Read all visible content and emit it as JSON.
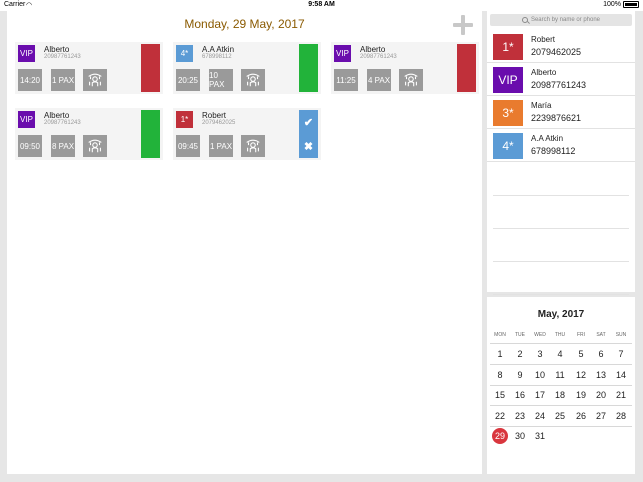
{
  "status_bar": {
    "carrier": "Carrier",
    "time": "9:58 AM",
    "battery": "100%"
  },
  "header": {
    "date": "Monday, 29 May, 2017"
  },
  "bookings": [
    {
      "badge": "VIP",
      "badge_color": "#6a0dad",
      "name": "Alberto",
      "phone": "20987761243",
      "time": "14:20",
      "pax": "1 PAX",
      "status": "red"
    },
    {
      "badge": "4*",
      "badge_color": "#5b9bd5",
      "name": "A.A Atkin",
      "phone": "678998112",
      "time": "20:25",
      "pax": "10 PAX",
      "status": "green"
    },
    {
      "badge": "VIP",
      "badge_color": "#6a0dad",
      "name": "Alberto",
      "phone": "20987761243",
      "time": "11:25",
      "pax": "4 PAX",
      "status": "red"
    },
    {
      "badge": "VIP",
      "badge_color": "#6a0dad",
      "name": "Alberto",
      "phone": "20987761243",
      "time": "09:50",
      "pax": "8 PAX",
      "status": "green"
    },
    {
      "badge": "1*",
      "badge_color": "#c0303a",
      "name": "Robert",
      "phone": "2079462025",
      "time": "09:45",
      "pax": "1 PAX",
      "status": "actions"
    }
  ],
  "actions": {
    "confirm_glyph": "✔",
    "cancel_glyph": "✖"
  },
  "search": {
    "placeholder": "Search by name or phone"
  },
  "contacts": [
    {
      "badge": "1*",
      "badge_color": "#c0303a",
      "name": "Robert",
      "phone": "2079462025"
    },
    {
      "badge": "VIP",
      "badge_color": "#6a0dad",
      "name": "Alberto",
      "phone": "20987761243"
    },
    {
      "badge": "3*",
      "badge_color": "#e97b2e",
      "name": "María",
      "phone": "2239876621"
    },
    {
      "badge": "4*",
      "badge_color": "#5b9bd5",
      "name": "A.A Atkin",
      "phone": "678998112"
    }
  ],
  "calendar": {
    "title": "May, 2017",
    "weekdays": [
      "MON",
      "TUE",
      "WED",
      "THU",
      "FRI",
      "SAT",
      "SUN"
    ],
    "weeks": [
      [
        "1",
        "2",
        "3",
        "4",
        "5",
        "6",
        "7"
      ],
      [
        "8",
        "9",
        "10",
        "11",
        "12",
        "13",
        "14"
      ],
      [
        "15",
        "16",
        "17",
        "18",
        "19",
        "20",
        "21"
      ],
      [
        "22",
        "23",
        "24",
        "25",
        "26",
        "27",
        "28"
      ],
      [
        "29",
        "30",
        "31"
      ]
    ],
    "selected_day": "29"
  }
}
